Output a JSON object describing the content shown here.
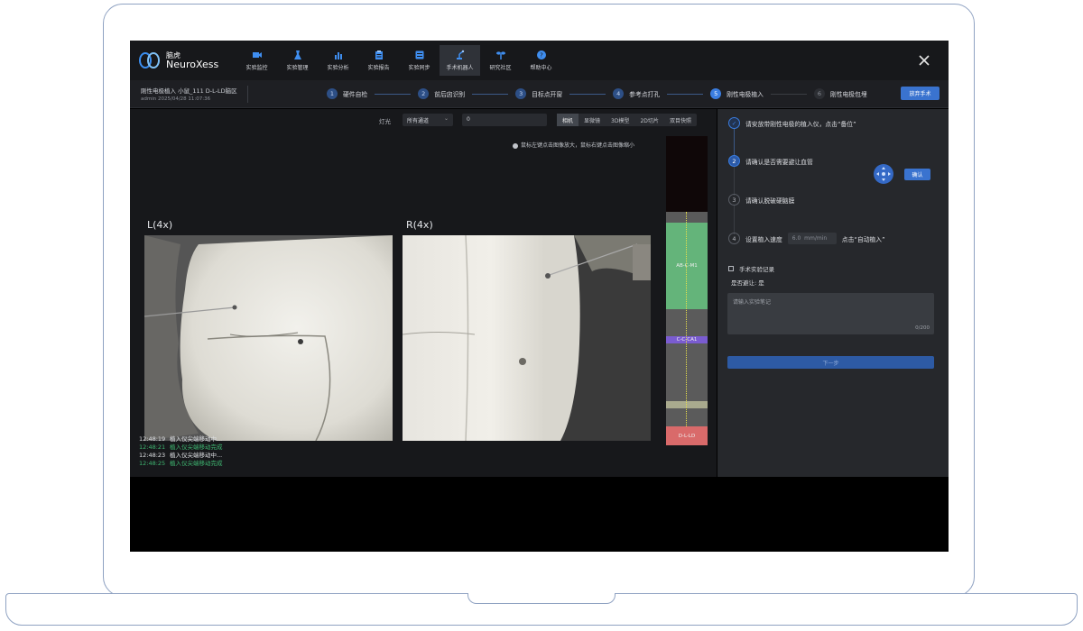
{
  "app": {
    "logo_cn": "脑虎",
    "logo_en": "NeuroXess"
  },
  "nav": {
    "items": [
      {
        "label": "实验监控",
        "icon": "video-icon"
      },
      {
        "label": "实验管理",
        "icon": "flask-icon"
      },
      {
        "label": "实验分析",
        "icon": "bar-chart-icon"
      },
      {
        "label": "实验报告",
        "icon": "clipboard-icon"
      },
      {
        "label": "实验同步",
        "icon": "sync-icon"
      },
      {
        "label": "手术机器人",
        "icon": "robot-arm-icon"
      },
      {
        "label": "研究社区",
        "icon": "sprout-icon"
      },
      {
        "label": "帮助中心",
        "icon": "help-icon"
      }
    ],
    "active_index": 5
  },
  "experiment": {
    "title": "刚性电极植入 小鼠_111 D-L-LD脑区",
    "meta": "admin 2025/04/28 11:07:36"
  },
  "steps": [
    {
      "num": "1",
      "label": "硬件自检"
    },
    {
      "num": "2",
      "label": "前后囟识别"
    },
    {
      "num": "3",
      "label": "目标点开窗"
    },
    {
      "num": "4",
      "label": "参考点打孔"
    },
    {
      "num": "5",
      "label": "刚性电极植入"
    },
    {
      "num": "6",
      "label": "刚性电极包埋"
    }
  ],
  "current_step": 5,
  "abort_label": "放弃手术",
  "toolbar": {
    "light_label": "灯光",
    "channel_value": "所有通道",
    "input_value": "0",
    "view_tabs": [
      "相机",
      "显微镜",
      "3D模型",
      "2D切片",
      "双目快照"
    ],
    "active_view": 0
  },
  "hint": "鼠标左键点击图像放大，鼠标右键点击图像缩小",
  "cameras": {
    "left_label": "L(4x)",
    "right_label": "R(4x)"
  },
  "log": [
    {
      "time": "12:48:19",
      "text": "植入仪尖端移动中...",
      "status": "info"
    },
    {
      "time": "12:48:21",
      "text": "植入仪尖端移动完成",
      "status": "success"
    },
    {
      "time": "12:48:23",
      "text": "植入仪尖端移动中...",
      "status": "info"
    },
    {
      "time": "12:48:25",
      "text": "植入仪尖端移动完成",
      "status": "success"
    }
  ],
  "depth": {
    "region_1": "AB-C-M1",
    "region_2": "C-C-CA1",
    "target": "D-L-LD"
  },
  "right_steps": [
    {
      "num": "✓",
      "text": "请安放带刚性电极的植入仪，点击“备位”",
      "state": "done"
    },
    {
      "num": "2",
      "text": "请确认是否需要避让血管",
      "state": "current"
    },
    {
      "num": "3",
      "text": "请确认脱破硬脑膜",
      "state": "future"
    },
    {
      "num": "4",
      "text": "设置植入速度",
      "state": "future"
    }
  ],
  "confirm_label": "确认",
  "speed": {
    "value": "6.0",
    "unit": "mm/min",
    "after": "点击“自动植入”"
  },
  "record": {
    "title": "手术实验记录",
    "avoid": "是否避让: 是",
    "placeholder": "请输入实验笔记",
    "count": "0/200"
  },
  "next_label": "下一步",
  "colors": {
    "accent": "#3a7de0",
    "success": "#3fb872",
    "region_green": "#64b47a",
    "region_purple": "#7a5cd0",
    "target_red": "#d96a6a"
  }
}
